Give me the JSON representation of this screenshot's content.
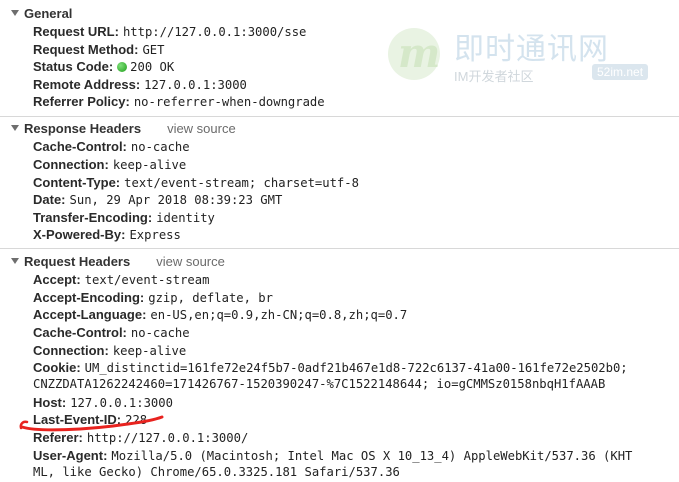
{
  "general": {
    "title": "General",
    "rows": [
      {
        "key": "Request URL:",
        "value": "http://127.0.0.1:3000/sse"
      },
      {
        "key": "Request Method:",
        "value": "GET"
      },
      {
        "key": "Status Code:",
        "value": "200 OK"
      },
      {
        "key": "Remote Address:",
        "value": "127.0.0.1:3000"
      },
      {
        "key": "Referrer Policy:",
        "value": "no-referrer-when-downgrade"
      }
    ]
  },
  "response_headers": {
    "title": "Response Headers",
    "view_source": "view source",
    "rows": [
      {
        "key": "Cache-Control:",
        "value": "no-cache"
      },
      {
        "key": "Connection:",
        "value": "keep-alive"
      },
      {
        "key": "Content-Type:",
        "value": "text/event-stream; charset=utf-8"
      },
      {
        "key": "Date:",
        "value": "Sun, 29 Apr 2018 08:39:23 GMT"
      },
      {
        "key": "Transfer-Encoding:",
        "value": "identity"
      },
      {
        "key": "X-Powered-By:",
        "value": "Express"
      }
    ]
  },
  "request_headers": {
    "title": "Request Headers",
    "view_source": "view source",
    "rows": [
      {
        "key": "Accept:",
        "value": "text/event-stream"
      },
      {
        "key": "Accept-Encoding:",
        "value": "gzip, deflate, br"
      },
      {
        "key": "Accept-Language:",
        "value": "en-US,en;q=0.9,zh-CN;q=0.8,zh;q=0.7"
      },
      {
        "key": "Cache-Control:",
        "value": "no-cache"
      },
      {
        "key": "Connection:",
        "value": "keep-alive"
      },
      {
        "key": "Cookie:",
        "value": "UM_distinctid=161fe72e24f5b7-0adf21b467e1d8-722c6137-41a00-161fe72e2502b0;",
        "cont": "CNZZDATA1262242460=171426767-1520390247-%7C1522148644; io=gCMMSz0158nbqH1fAAAB"
      },
      {
        "key": "Host:",
        "value": "127.0.0.1:3000"
      },
      {
        "key": "Last-Event-ID:",
        "value": "228"
      },
      {
        "key": "Referer:",
        "value": "http://127.0.0.1:3000/"
      },
      {
        "key": "User-Agent:",
        "value": "Mozilla/5.0 (Macintosh; Intel Mac OS X 10_13_4) AppleWebKit/537.36 (KHT",
        "cont": "ML, like Gecko) Chrome/65.0.3325.181 Safari/537.36"
      }
    ]
  },
  "watermark": {
    "logo_letter": "m",
    "title": "即时通讯网",
    "subtitle": "IM开发者社区",
    "site": "52im.net"
  },
  "colors": {
    "status_ok": "#1f9e1a",
    "annotation": "#e8231f"
  }
}
